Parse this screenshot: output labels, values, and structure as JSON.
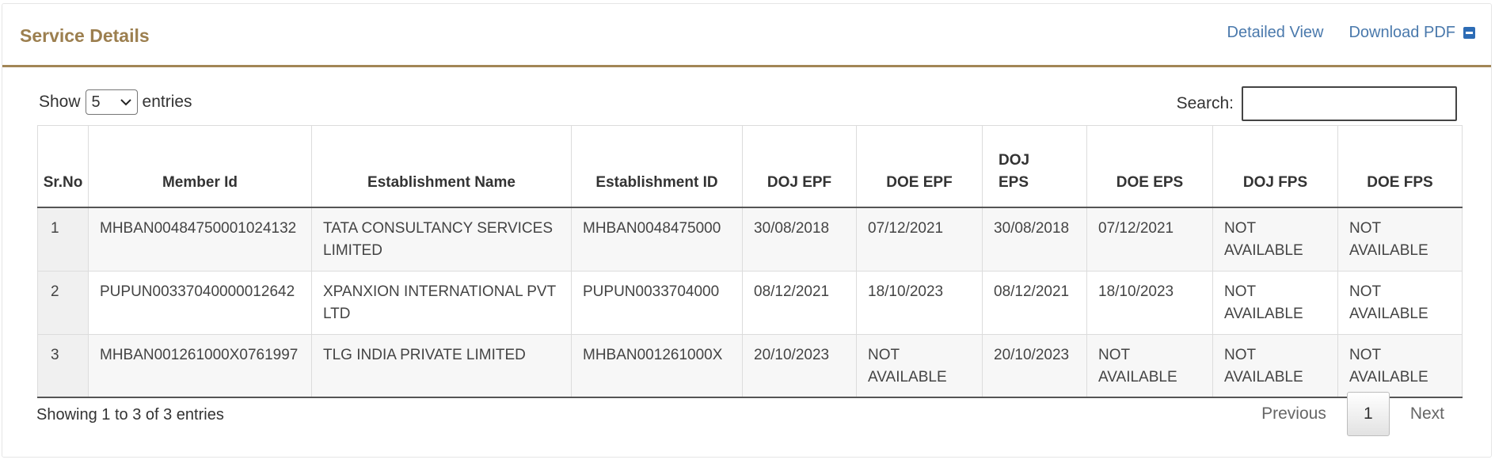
{
  "panel": {
    "title": "Service Details",
    "detailed_view_label": "Detailed View",
    "download_pdf_label": "Download PDF"
  },
  "length": {
    "show_label": "Show",
    "selected": "5",
    "entries_label": "entries"
  },
  "search": {
    "label": "Search:",
    "value": ""
  },
  "table": {
    "headers": [
      "Sr.No",
      "Member Id",
      "Establishment Name",
      "Establishment ID",
      "DOJ EPF",
      "DOE EPF",
      "DOJ EPS",
      "DOE EPS",
      "DOJ FPS",
      "DOE FPS"
    ],
    "rows": [
      [
        "1",
        "MHBAN00484750001024132",
        "TATA CONSULTANCY SERVICES LIMITED",
        "MHBAN0048475000",
        "30/08/2018",
        "07/12/2021",
        "30/08/2018",
        "07/12/2021",
        "NOT AVAILABLE",
        "NOT AVAILABLE"
      ],
      [
        "2",
        "PUPUN00337040000012642",
        "XPANXION INTERNATIONAL PVT LTD",
        "PUPUN0033704000",
        "08/12/2021",
        "18/10/2023",
        "08/12/2021",
        "18/10/2023",
        "NOT AVAILABLE",
        "NOT AVAILABLE"
      ],
      [
        "3",
        "MHBAN001261000X0761997",
        "TLG INDIA PRIVATE LIMITED",
        "MHBAN001261000X",
        "20/10/2023",
        "NOT AVAILABLE",
        "20/10/2023",
        "NOT AVAILABLE",
        "NOT AVAILABLE",
        "NOT AVAILABLE"
      ]
    ]
  },
  "footer": {
    "info": "Showing 1 to 3 of 3 entries",
    "previous_label": "Previous",
    "current_page": "1",
    "next_label": "Next"
  },
  "colors": {
    "title": "#9c7f4f",
    "header_rule": "#a28656",
    "link": "#4a79ac",
    "collapse_icon": "#2d6cb5"
  },
  "icons": {
    "collapse": "minus-square-icon",
    "dropdown": "chevron-down-icon"
  }
}
